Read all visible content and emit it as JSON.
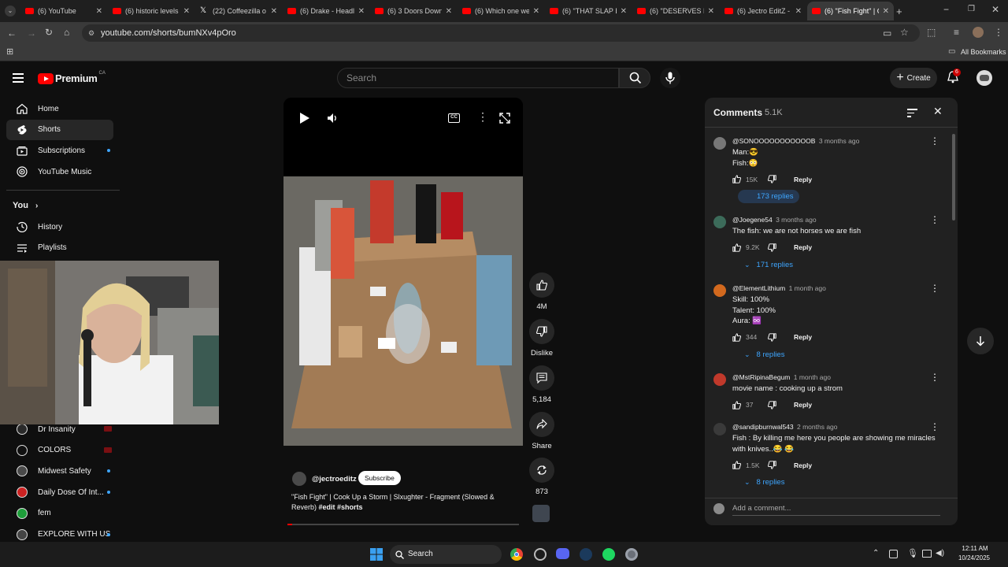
{
  "browser": {
    "tabs": [
      {
        "title": "(6) YouTube",
        "type": "yt"
      },
      {
        "title": "(6) historic levels",
        "type": "yt"
      },
      {
        "title": "(22) Coffeezilla o",
        "type": "x"
      },
      {
        "title": "(6) Drake - Headli",
        "type": "yt"
      },
      {
        "title": "(6) 3 Doors Down",
        "type": "yt"
      },
      {
        "title": "(6) Which one we",
        "type": "yt"
      },
      {
        "title": "(6) \"THAT SLAP E",
        "type": "yt"
      },
      {
        "title": "(6) \"DESERVES RE",
        "type": "yt"
      },
      {
        "title": "(6) Jectro EditZ - Y",
        "type": "yt"
      },
      {
        "title": "(6) \"Fish Fight\" | C",
        "type": "yt",
        "active": true
      }
    ],
    "url": "youtube.com/shorts/bumNXv4pOro",
    "bookmarks_label": "All Bookmarks"
  },
  "header": {
    "brand": "Premium",
    "region": "CA",
    "search_placeholder": "Search",
    "create_label": "Create",
    "notif_count": "6"
  },
  "sidebar": {
    "main": [
      {
        "label": "Home",
        "icon": "home-icon"
      },
      {
        "label": "Shorts",
        "icon": "shorts-icon",
        "active": true
      },
      {
        "label": "Subscriptions",
        "icon": "subscriptions-icon",
        "dot": true
      },
      {
        "label": "YouTube Music",
        "icon": "music-icon"
      }
    ],
    "you_label": "You",
    "you": [
      {
        "label": "History",
        "icon": "history-icon"
      },
      {
        "label": "Playlists",
        "icon": "playlists-icon"
      }
    ],
    "subs": [
      {
        "label": "Dr Insanity",
        "live": true
      },
      {
        "label": "COLORS",
        "live": true
      },
      {
        "label": "Midwest Safety",
        "dot": true
      },
      {
        "label": "Daily Dose Of Int...",
        "dot": true
      },
      {
        "label": "fem"
      },
      {
        "label": "EXPLORE WITH US",
        "dot": true
      }
    ]
  },
  "short": {
    "channel": "@jectroeditz",
    "subscribe_label": "Subscribe",
    "title_plain": "\"Fish Fight\" | Cook Up a Storm | Slxughter - Fragment (Slowed & Reverb) ",
    "hashtags": "#edit #shorts",
    "likes": "4M",
    "dislike_label": "Dislike",
    "comments_count": "5,184",
    "share_label": "Share",
    "remix_count": "873"
  },
  "comments": {
    "title": "Comments",
    "count": "5.1K",
    "add_placeholder": "Add a comment...",
    "reply_label": "Reply",
    "items": [
      {
        "user": "@SONOOOOOOOOOOOB",
        "time": "3 months ago",
        "text": "Man:😎\nFish:😳",
        "likes": "15K",
        "replies": "173 replies"
      },
      {
        "user": "@Joegene54",
        "time": "3 months ago",
        "text": "The fish: we are not horses we are fish",
        "likes": "9.2K",
        "replies": "171 replies"
      },
      {
        "user": "@ElementLithium",
        "time": "1 month ago",
        "text": "Skill: 100%\nTalent: 100%\nAura: ♾️",
        "likes": "344",
        "replies": "8 replies"
      },
      {
        "user": "@MstRipinaBegum",
        "time": "1 month ago",
        "text": "movie name : cooking up a strom",
        "likes": "37",
        "replies": ""
      },
      {
        "user": "@sandipburnwal543",
        "time": "2 months ago",
        "text": "Fish : By killing me here you people are showing me miracles\nwith knives..😂 😂",
        "likes": "1.5K",
        "replies": "8 replies"
      }
    ]
  },
  "taskbar": {
    "search_label": "Search",
    "time": "12:11 AM",
    "date": "10/24/2025"
  }
}
